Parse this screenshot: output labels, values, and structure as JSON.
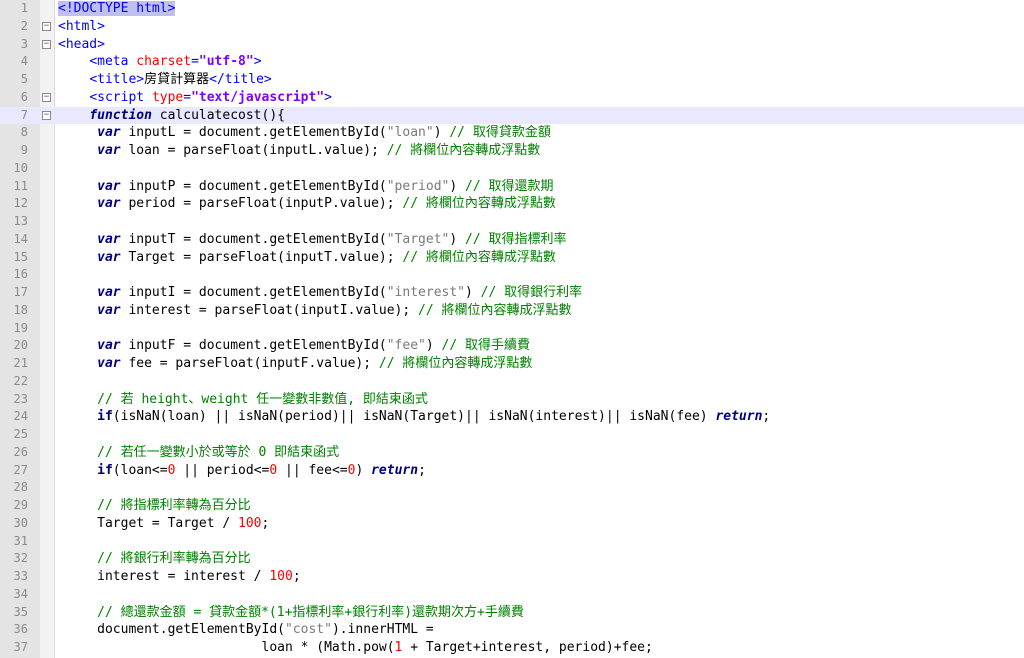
{
  "editor": {
    "lines": [
      {
        "n": "1",
        "tokens": [
          {
            "t": "tag",
            "v": "<!DOCTYPE html>",
            "h": true
          }
        ]
      },
      {
        "n": "2",
        "fold": "minus",
        "tokens": [
          {
            "t": "tag",
            "v": "<html>"
          }
        ]
      },
      {
        "n": "3",
        "fold": "minus",
        "tokens": [
          {
            "t": "tag",
            "v": "<head>"
          }
        ]
      },
      {
        "n": "4",
        "tokens": [
          {
            "t": "plain",
            "v": "    "
          },
          {
            "t": "tag",
            "v": "<meta "
          },
          {
            "t": "attr",
            "v": "charset"
          },
          {
            "t": "tag",
            "v": "="
          },
          {
            "t": "str",
            "v": "\"utf-8\""
          },
          {
            "t": "tag",
            "v": ">"
          }
        ]
      },
      {
        "n": "5",
        "tokens": [
          {
            "t": "plain",
            "v": "    "
          },
          {
            "t": "tag",
            "v": "<title>"
          },
          {
            "t": "plain",
            "v": "房貸計算器"
          },
          {
            "t": "tag",
            "v": "</title>"
          }
        ]
      },
      {
        "n": "6",
        "fold": "minus",
        "tokens": [
          {
            "t": "plain",
            "v": "    "
          },
          {
            "t": "tag",
            "v": "<script "
          },
          {
            "t": "attr",
            "v": "type"
          },
          {
            "t": "tag",
            "v": "="
          },
          {
            "t": "str",
            "v": "\"text/javascript\""
          },
          {
            "t": "tag",
            "v": ">"
          }
        ]
      },
      {
        "n": "7",
        "fold": "minus",
        "current": true,
        "tokens": [
          {
            "t": "plain",
            "v": "    "
          },
          {
            "t": "fn",
            "v": "function"
          },
          {
            "t": "plain",
            "v": " calculatecost(){"
          }
        ]
      },
      {
        "n": "8",
        "tokens": [
          {
            "t": "plain",
            "v": "     "
          },
          {
            "t": "kwi",
            "v": "var"
          },
          {
            "t": "plain",
            "v": " inputL = document.getElementById("
          },
          {
            "t": "jstr",
            "v": "\"loan\""
          },
          {
            "t": "plain",
            "v": ") "
          },
          {
            "t": "cmt",
            "v": "// 取得貸款金額"
          }
        ]
      },
      {
        "n": "9",
        "tokens": [
          {
            "t": "plain",
            "v": "     "
          },
          {
            "t": "kwi",
            "v": "var"
          },
          {
            "t": "plain",
            "v": " loan = parseFloat(inputL.value); "
          },
          {
            "t": "cmt",
            "v": "// 將欄位內容轉成浮點數"
          }
        ]
      },
      {
        "n": "10",
        "tokens": []
      },
      {
        "n": "11",
        "tokens": [
          {
            "t": "plain",
            "v": "     "
          },
          {
            "t": "kwi",
            "v": "var"
          },
          {
            "t": "plain",
            "v": " inputP = document.getElementById("
          },
          {
            "t": "jstr",
            "v": "\"period\""
          },
          {
            "t": "plain",
            "v": ") "
          },
          {
            "t": "cmt",
            "v": "// 取得還款期"
          }
        ]
      },
      {
        "n": "12",
        "tokens": [
          {
            "t": "plain",
            "v": "     "
          },
          {
            "t": "kwi",
            "v": "var"
          },
          {
            "t": "plain",
            "v": " period = parseFloat(inputP.value); "
          },
          {
            "t": "cmt",
            "v": "// 將欄位內容轉成浮點數"
          }
        ]
      },
      {
        "n": "13",
        "tokens": []
      },
      {
        "n": "14",
        "tokens": [
          {
            "t": "plain",
            "v": "     "
          },
          {
            "t": "kwi",
            "v": "var"
          },
          {
            "t": "plain",
            "v": " inputT = document.getElementById("
          },
          {
            "t": "jstr",
            "v": "\"Target\""
          },
          {
            "t": "plain",
            "v": ") "
          },
          {
            "t": "cmt",
            "v": "// 取得指標利率"
          }
        ]
      },
      {
        "n": "15",
        "tokens": [
          {
            "t": "plain",
            "v": "     "
          },
          {
            "t": "kwi",
            "v": "var"
          },
          {
            "t": "plain",
            "v": " Target = parseFloat(inputT.value); "
          },
          {
            "t": "cmt",
            "v": "// 將欄位內容轉成浮點數"
          }
        ]
      },
      {
        "n": "16",
        "tokens": []
      },
      {
        "n": "17",
        "tokens": [
          {
            "t": "plain",
            "v": "     "
          },
          {
            "t": "kwi",
            "v": "var"
          },
          {
            "t": "plain",
            "v": " inputI = document.getElementById("
          },
          {
            "t": "jstr",
            "v": "\"interest\""
          },
          {
            "t": "plain",
            "v": ") "
          },
          {
            "t": "cmt",
            "v": "// 取得銀行利率"
          }
        ]
      },
      {
        "n": "18",
        "tokens": [
          {
            "t": "plain",
            "v": "     "
          },
          {
            "t": "kwi",
            "v": "var"
          },
          {
            "t": "plain",
            "v": " interest = parseFloat(inputI.value); "
          },
          {
            "t": "cmt",
            "v": "// 將欄位內容轉成浮點數"
          }
        ]
      },
      {
        "n": "19",
        "tokens": []
      },
      {
        "n": "20",
        "tokens": [
          {
            "t": "plain",
            "v": "     "
          },
          {
            "t": "kwi",
            "v": "var"
          },
          {
            "t": "plain",
            "v": " inputF = document.getElementById("
          },
          {
            "t": "jstr",
            "v": "\"fee\""
          },
          {
            "t": "plain",
            "v": ") "
          },
          {
            "t": "cmt",
            "v": "// 取得手續費"
          }
        ]
      },
      {
        "n": "21",
        "tokens": [
          {
            "t": "plain",
            "v": "     "
          },
          {
            "t": "kwi",
            "v": "var"
          },
          {
            "t": "plain",
            "v": " fee = parseFloat(inputF.value); "
          },
          {
            "t": "cmt",
            "v": "// 將欄位內容轉成浮點數"
          }
        ]
      },
      {
        "n": "22",
        "tokens": []
      },
      {
        "n": "23",
        "tokens": [
          {
            "t": "plain",
            "v": "     "
          },
          {
            "t": "cmt",
            "v": "// 若 height、weight 任一變數非數值, 即結束函式"
          }
        ]
      },
      {
        "n": "24",
        "tokens": [
          {
            "t": "plain",
            "v": "     "
          },
          {
            "t": "kw",
            "v": "if"
          },
          {
            "t": "plain",
            "v": "(isNaN(loan) || isNaN(period)|| isNaN(Target)|| isNaN(interest)|| isNaN(fee) "
          },
          {
            "t": "kwi",
            "v": "return"
          },
          {
            "t": "plain",
            "v": ";"
          }
        ]
      },
      {
        "n": "25",
        "tokens": []
      },
      {
        "n": "26",
        "tokens": [
          {
            "t": "plain",
            "v": "     "
          },
          {
            "t": "cmt",
            "v": "// 若任一變數小於或等於 0 即結束函式"
          }
        ]
      },
      {
        "n": "27",
        "tokens": [
          {
            "t": "plain",
            "v": "     "
          },
          {
            "t": "kw",
            "v": "if"
          },
          {
            "t": "plain",
            "v": "(loan<="
          },
          {
            "t": "num",
            "v": "0"
          },
          {
            "t": "plain",
            "v": " || period<="
          },
          {
            "t": "num",
            "v": "0"
          },
          {
            "t": "plain",
            "v": " || fee<="
          },
          {
            "t": "num",
            "v": "0"
          },
          {
            "t": "plain",
            "v": ") "
          },
          {
            "t": "kwi",
            "v": "return"
          },
          {
            "t": "plain",
            "v": ";"
          }
        ]
      },
      {
        "n": "28",
        "tokens": []
      },
      {
        "n": "29",
        "tokens": [
          {
            "t": "plain",
            "v": "     "
          },
          {
            "t": "cmt",
            "v": "// 將指標利率轉為百分比"
          }
        ]
      },
      {
        "n": "30",
        "tokens": [
          {
            "t": "plain",
            "v": "     Target = Target / "
          },
          {
            "t": "num",
            "v": "100"
          },
          {
            "t": "plain",
            "v": ";"
          }
        ]
      },
      {
        "n": "31",
        "tokens": []
      },
      {
        "n": "32",
        "tokens": [
          {
            "t": "plain",
            "v": "     "
          },
          {
            "t": "cmt",
            "v": "// 將銀行利率轉為百分比"
          }
        ]
      },
      {
        "n": "33",
        "tokens": [
          {
            "t": "plain",
            "v": "     interest = interest / "
          },
          {
            "t": "num",
            "v": "100"
          },
          {
            "t": "plain",
            "v": ";"
          }
        ]
      },
      {
        "n": "34",
        "tokens": []
      },
      {
        "n": "35",
        "tokens": [
          {
            "t": "plain",
            "v": "     "
          },
          {
            "t": "cmt",
            "v": "// 總還款金額 = 貸款金額*(1+指標利率+銀行利率)還款期次方+手續費"
          }
        ]
      },
      {
        "n": "36",
        "tokens": [
          {
            "t": "plain",
            "v": "     document.getElementById("
          },
          {
            "t": "jstr",
            "v": "\"cost\""
          },
          {
            "t": "plain",
            "v": ").innerHTML ="
          }
        ]
      },
      {
        "n": "37",
        "tokens": [
          {
            "t": "plain",
            "v": "                          loan * (Math.pow("
          },
          {
            "t": "num",
            "v": "1"
          },
          {
            "t": "plain",
            "v": " + Target+interest, period)+fee;"
          }
        ]
      }
    ]
  }
}
